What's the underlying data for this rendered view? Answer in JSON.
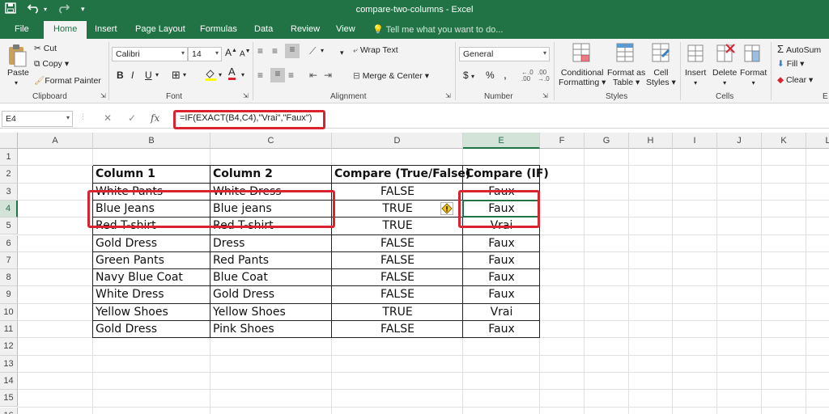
{
  "window": {
    "title": "compare-two-columns - Excel"
  },
  "tabs": [
    "File",
    "Home",
    "Insert",
    "Page Layout",
    "Formulas",
    "Data",
    "Review",
    "View"
  ],
  "active_tab": "Home",
  "tell_me": "Tell me what you want to do...",
  "ribbon": {
    "clipboard": {
      "paste": "Paste",
      "cut": "Cut",
      "copy": "Copy",
      "format_painter": "Format Painter",
      "label": "Clipboard"
    },
    "font": {
      "name": "Calibri",
      "size": "14",
      "bold": "B",
      "italic": "I",
      "underline": "U",
      "label": "Font"
    },
    "alignment": {
      "wrap": "Wrap Text",
      "merge": "Merge & Center",
      "label": "Alignment"
    },
    "number": {
      "format": "General",
      "currency": "$",
      "percent": "%",
      "comma": ",",
      "label": "Number"
    },
    "styles": {
      "conditional": [
        "Conditional",
        "Formatting"
      ],
      "format_table": [
        "Format as",
        "Table"
      ],
      "cell_styles": [
        "Cell",
        "Styles"
      ],
      "label": "Styles"
    },
    "cells": {
      "insert": "Insert",
      "delete": "Delete",
      "format": "Format",
      "label": "Cells"
    },
    "editing": {
      "autosum": "AutoSum",
      "fill": "Fill",
      "clear": "Clear",
      "label": "E"
    }
  },
  "formula_bar": {
    "name_box": "E4",
    "formula": "=IF(EXACT(B4,C4),\"Vrai\",\"Faux\")"
  },
  "accent_color": "#217346",
  "highlight_color": "#d9242f",
  "columns": [
    "A",
    "B",
    "C",
    "D",
    "E",
    "F",
    "G",
    "H",
    "I",
    "J",
    "K",
    "L"
  ],
  "rows": [
    "1",
    "2",
    "3",
    "4",
    "5",
    "6",
    "7",
    "8",
    "9",
    "10",
    "11",
    "12",
    "13",
    "14",
    "15",
    "16"
  ],
  "selected_cell": "E4",
  "table": {
    "headers": [
      "Column 1",
      "Column 2",
      "Compare  (True/False)",
      "Compare (IF)"
    ],
    "rows": [
      [
        "White Pants",
        "White Dress",
        "FALSE",
        "Faux"
      ],
      [
        "Blue Jeans",
        "Blue jeans",
        "TRUE",
        "Faux"
      ],
      [
        "Red T-shirt",
        "Red T-shirt",
        "TRUE",
        "Vrai"
      ],
      [
        "Gold Dress",
        "Dress",
        "FALSE",
        "Faux"
      ],
      [
        "Green Pants",
        "Red Pants",
        "FALSE",
        "Faux"
      ],
      [
        "Navy Blue Coat",
        "Blue Coat",
        "FALSE",
        "Faux"
      ],
      [
        "White Dress",
        "Gold Dress",
        "FALSE",
        "Faux"
      ],
      [
        "Yellow Shoes",
        "Yellow Shoes",
        "TRUE",
        "Vrai"
      ],
      [
        "Gold Dress",
        "Pink Shoes",
        "FALSE",
        "Faux"
      ]
    ]
  }
}
